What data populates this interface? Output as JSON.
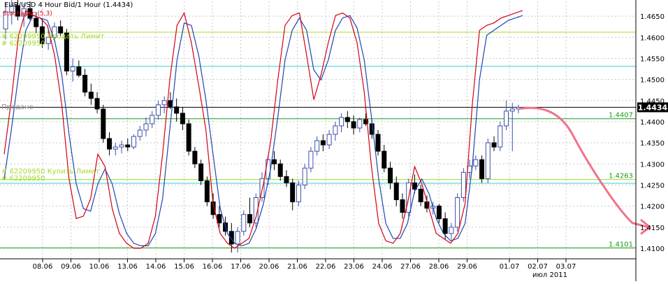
{
  "header": {
    "title": "EUR/USD 4 Hour Bid/1 Hour (1.4434)",
    "stochastic_label": "Stochastic (5,3)"
  },
  "colors": {
    "background": "#ffffff",
    "grid": "#c8c8c8",
    "candle_up": "#3c4ea8",
    "candle_down": "#000000",
    "stoch_k": "#d20014",
    "stoch_d": "#1e46b4",
    "level_yellowgreen": "#a8d830",
    "level_green": "#1a9a1a",
    "level_cyan": "#30d0d0",
    "level_black": "#000000",
    "forecast": "#f0738a",
    "axis_text": "#000000"
  },
  "annotations": {
    "sell_order_top": "# 62209950 Продать Лимит",
    "sell_ticket_top": "# 62209950",
    "sold": "Продано",
    "buy_order": "# 62209950 Купить Лимит",
    "buy_ticket": "# 62209950"
  },
  "chart_data": {
    "type": "candlestick",
    "title": "EUR/USD 4 Hour Bid/1 Hour (1.4434)",
    "y_axis": {
      "ticks": [
        1.41,
        1.415,
        1.42,
        1.425,
        1.43,
        1.435,
        1.44,
        1.445,
        1.45,
        1.455,
        1.46,
        1.465
      ],
      "ylim": [
        1.4075,
        1.4685
      ]
    },
    "x_axis": {
      "labels": [
        "08.06",
        "09.06",
        "10.06",
        "13.06",
        "14.06",
        "15.06",
        "16.06",
        "17.06",
        "20.06",
        "21.06",
        "22.06",
        "23.06",
        "24.06",
        "27.06",
        "28.06",
        "29.06",
        "01.07",
        "02.07",
        "03.07"
      ],
      "month_label": "июл 2011"
    },
    "grid": true,
    "candles_ohlc": [
      [
        1.462,
        1.468,
        1.4595,
        1.466
      ],
      [
        1.466,
        1.469,
        1.463,
        1.4675
      ],
      [
        1.4675,
        1.469,
        1.464,
        1.465
      ],
      [
        1.465,
        1.468,
        1.4625,
        1.4668
      ],
      [
        1.4668,
        1.4685,
        1.464,
        1.4645
      ],
      [
        1.4645,
        1.466,
        1.461,
        1.4625
      ],
      [
        1.4625,
        1.4645,
        1.4575,
        1.4585
      ],
      [
        1.4585,
        1.462,
        1.457,
        1.46
      ],
      [
        1.46,
        1.4635,
        1.459,
        1.4625
      ],
      [
        1.4625,
        1.464,
        1.46,
        1.461
      ],
      [
        1.461,
        1.462,
        1.451,
        1.452
      ],
      [
        1.452,
        1.455,
        1.4495,
        1.453
      ],
      [
        1.453,
        1.4545,
        1.4505,
        1.451
      ],
      [
        1.451,
        1.4525,
        1.446,
        1.447
      ],
      [
        1.447,
        1.449,
        1.444,
        1.4455
      ],
      [
        1.4455,
        1.447,
        1.442,
        1.443
      ],
      [
        1.443,
        1.444,
        1.435,
        1.436
      ],
      [
        1.436,
        1.4375,
        1.432,
        1.4335
      ],
      [
        1.4335,
        1.435,
        1.432,
        1.434
      ],
      [
        1.434,
        1.4355,
        1.4325,
        1.4345
      ],
      [
        1.4345,
        1.436,
        1.433,
        1.434
      ],
      [
        1.434,
        1.437,
        1.4335,
        1.4365
      ],
      [
        1.4365,
        1.439,
        1.4355,
        1.438
      ],
      [
        1.438,
        1.441,
        1.4365,
        1.4395
      ],
      [
        1.4395,
        1.4425,
        1.4385,
        1.4415
      ],
      [
        1.4415,
        1.445,
        1.4405,
        1.444
      ],
      [
        1.444,
        1.446,
        1.442,
        1.445
      ],
      [
        1.445,
        1.447,
        1.443,
        1.4435
      ],
      [
        1.4435,
        1.4455,
        1.44,
        1.442
      ],
      [
        1.442,
        1.4435,
        1.438,
        1.4395
      ],
      [
        1.4395,
        1.4405,
        1.432,
        1.433
      ],
      [
        1.433,
        1.434,
        1.429,
        1.43
      ],
      [
        1.43,
        1.431,
        1.425,
        1.426
      ],
      [
        1.426,
        1.427,
        1.42,
        1.421
      ],
      [
        1.421,
        1.423,
        1.417,
        1.418
      ],
      [
        1.418,
        1.42,
        1.415,
        1.416
      ],
      [
        1.416,
        1.4175,
        1.413,
        1.414
      ],
      [
        1.414,
        1.416,
        1.409,
        1.411
      ],
      [
        1.411,
        1.415,
        1.409,
        1.414
      ],
      [
        1.414,
        1.419,
        1.413,
        1.418
      ],
      [
        1.418,
        1.422,
        1.415,
        1.416
      ],
      [
        1.416,
        1.423,
        1.415,
        1.422
      ],
      [
        1.422,
        1.428,
        1.421,
        1.4265
      ],
      [
        1.4265,
        1.432,
        1.425,
        1.431
      ],
      [
        1.431,
        1.433,
        1.4285,
        1.43
      ],
      [
        1.43,
        1.431,
        1.426,
        1.427
      ],
      [
        1.427,
        1.4285,
        1.4245,
        1.4255
      ],
      [
        1.4255,
        1.4265,
        1.419,
        1.421
      ],
      [
        1.421,
        1.426,
        1.42,
        1.425
      ],
      [
        1.425,
        1.43,
        1.424,
        1.429
      ],
      [
        1.429,
        1.434,
        1.428,
        1.433
      ],
      [
        1.433,
        1.4365,
        1.432,
        1.4355
      ],
      [
        1.4355,
        1.437,
        1.433,
        1.4345
      ],
      [
        1.4345,
        1.438,
        1.4335,
        1.437
      ],
      [
        1.437,
        1.44,
        1.4355,
        1.439
      ],
      [
        1.439,
        1.442,
        1.4375,
        1.441
      ],
      [
        1.441,
        1.4425,
        1.4385,
        1.44
      ],
      [
        1.44,
        1.4415,
        1.437,
        1.4385
      ],
      [
        1.4385,
        1.441,
        1.4375,
        1.4405
      ],
      [
        1.4405,
        1.442,
        1.439,
        1.4395
      ],
      [
        1.4395,
        1.4405,
        1.436,
        1.437
      ],
      [
        1.437,
        1.438,
        1.432,
        1.433
      ],
      [
        1.433,
        1.4345,
        1.428,
        1.429
      ],
      [
        1.429,
        1.4305,
        1.424,
        1.4255
      ],
      [
        1.4255,
        1.427,
        1.42,
        1.4215
      ],
      [
        1.4215,
        1.423,
        1.417,
        1.4185
      ],
      [
        1.4185,
        1.4265,
        1.4175,
        1.4255
      ],
      [
        1.4255,
        1.4275,
        1.423,
        1.424
      ],
      [
        1.424,
        1.425,
        1.42,
        1.421
      ],
      [
        1.421,
        1.4225,
        1.4185,
        1.4195
      ],
      [
        1.4195,
        1.421,
        1.418,
        1.42
      ],
      [
        1.42,
        1.4205,
        1.416,
        1.417
      ],
      [
        1.417,
        1.4185,
        1.412,
        1.4135
      ],
      [
        1.4135,
        1.416,
        1.412,
        1.415
      ],
      [
        1.415,
        1.423,
        1.414,
        1.422
      ],
      [
        1.422,
        1.429,
        1.421,
        1.428
      ],
      [
        1.428,
        1.431,
        1.4265,
        1.4295
      ],
      [
        1.4295,
        1.432,
        1.4285,
        1.431
      ],
      [
        1.431,
        1.432,
        1.4255,
        1.4265
      ],
      [
        1.4265,
        1.436,
        1.4255,
        1.435
      ],
      [
        1.435,
        1.4365,
        1.433,
        1.434
      ],
      [
        1.434,
        1.44,
        1.433,
        1.439
      ],
      [
        1.439,
        1.445,
        1.438,
        1.4425
      ],
      [
        1.4425,
        1.4445,
        1.433,
        1.443
      ],
      [
        1.443,
        1.444,
        1.442,
        1.4434
      ]
    ],
    "stochastic": {
      "k": [
        40,
        62,
        88,
        98,
        96,
        95,
        92,
        80,
        60,
        30,
        14,
        15,
        22,
        40,
        35,
        18,
        8,
        4,
        2,
        2,
        4,
        15,
        40,
        70,
        92,
        97,
        85,
        68,
        50,
        20,
        8,
        4,
        2,
        4,
        6,
        15,
        28,
        45,
        70,
        92,
        96,
        97,
        80,
        62,
        72,
        85,
        96,
        97,
        95,
        85,
        65,
        35,
        12,
        5,
        4,
        8,
        20,
        35,
        28,
        18,
        8,
        6,
        4,
        8,
        20,
        60,
        90,
        92,
        93,
        95,
        96,
        97,
        98
      ],
      "d": [
        30,
        50,
        72,
        90,
        96,
        95,
        94,
        86,
        72,
        48,
        28,
        18,
        17,
        28,
        34,
        28,
        16,
        8,
        4,
        3,
        3,
        8,
        22,
        50,
        78,
        93,
        92,
        80,
        62,
        40,
        18,
        8,
        4,
        3,
        4,
        10,
        20,
        34,
        55,
        78,
        90,
        95,
        90,
        74,
        70,
        78,
        90,
        95,
        96,
        91,
        78,
        55,
        30,
        12,
        6,
        6,
        12,
        25,
        30,
        24,
        14,
        8,
        5,
        6,
        12,
        35,
        70,
        88,
        90,
        92,
        94,
        95,
        96
      ]
    },
    "levels": [
      {
        "price": 1.4612,
        "name": "sell limit",
        "color": "#a8d830"
      },
      {
        "price": 1.4531,
        "name": "",
        "color": "#30d0d0"
      },
      {
        "price": 1.4434,
        "name": "sold",
        "color": "#000000",
        "label": "1.4434"
      },
      {
        "price": 1.4407,
        "name": "",
        "color": "#1a9a1a",
        "label": "1.4407"
      },
      {
        "price": 1.4263,
        "name": "buy limit",
        "color": "#a8d830",
        "label": "1.4263"
      },
      {
        "price": 1.4254,
        "name": "",
        "color": "#30d0d0"
      },
      {
        "price": 1.4101,
        "name": "",
        "color": "#1a9a1a",
        "label": "1.4101"
      }
    ],
    "forecast_target": 1.415,
    "current_price": 1.4434
  }
}
